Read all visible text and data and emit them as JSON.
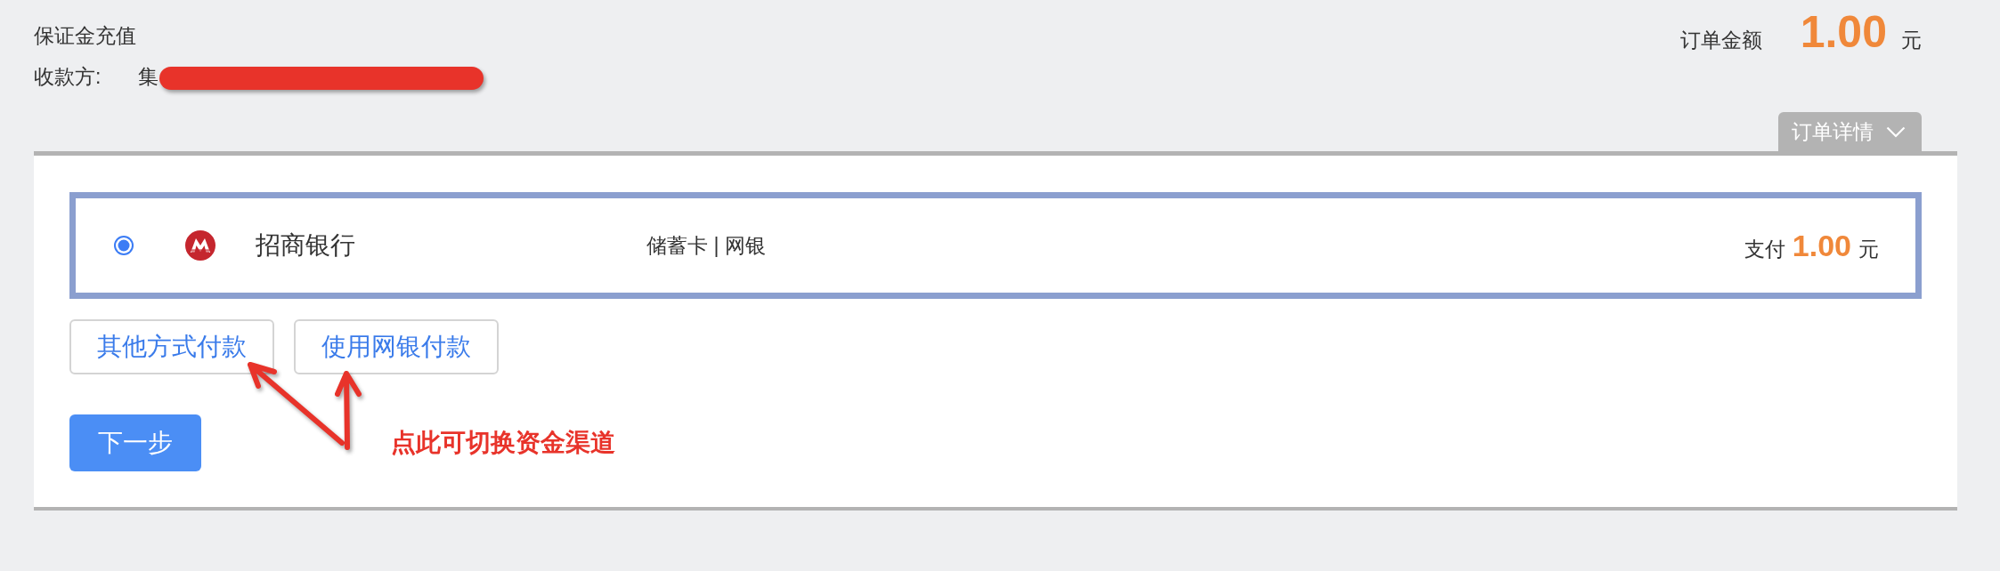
{
  "header": {
    "title": "保证金充值",
    "payee": {
      "label": "收款方:",
      "value": "集",
      "redacted": true
    },
    "order_amount": {
      "label": "订单金额",
      "amount": "1.00",
      "currency": "元"
    }
  },
  "details_tab": {
    "label": "订单详情"
  },
  "payment_methods": [
    {
      "bank": "招商银行",
      "card_type": "储蓄卡 | 网银",
      "pay_label": "支付",
      "amount": "1.00",
      "currency": "元",
      "selected": true
    }
  ],
  "switch_buttons": [
    {
      "label": "其他方式付款",
      "annotated": true
    },
    {
      "label": "使用网银付款",
      "annotated": true
    }
  ],
  "next_button": {
    "label": "下一步"
  },
  "annotation": {
    "note": "点此可切换资金渠道"
  }
}
